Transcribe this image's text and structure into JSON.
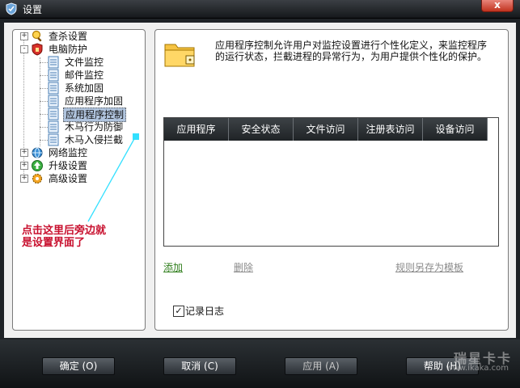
{
  "window": {
    "title": "设置",
    "close_label": "x"
  },
  "tree": {
    "items": [
      {
        "label": "查杀设置",
        "expander": "+"
      },
      {
        "label": "电脑防护",
        "expander": "-"
      },
      {
        "label": "文件监控"
      },
      {
        "label": "邮件监控"
      },
      {
        "label": "系统加固"
      },
      {
        "label": "应用程序加固"
      },
      {
        "label": "应用程序控制",
        "selected": true
      },
      {
        "label": "木马行为防御"
      },
      {
        "label": "木马入侵拦截"
      },
      {
        "label": "网络监控",
        "expander": "+"
      },
      {
        "label": "升级设置",
        "expander": "+"
      },
      {
        "label": "高级设置",
        "expander": "+"
      }
    ]
  },
  "annotation": {
    "line1": "点击这里后旁边就",
    "line2": "是设置界面了"
  },
  "panel": {
    "description": "应用程序控制允许用户对监控设置进行个性化定义，来监控程序的运行状态，拦截进程的异常行为，为用户提供个性化的保护。",
    "table_headers": [
      "应用程序",
      "安全状态",
      "文件访问",
      "注册表访问",
      "设备访问"
    ],
    "links": {
      "add": "添加",
      "delete": "删除",
      "save_template": "规则另存为模板"
    },
    "log_checkbox": {
      "label": "记录日志",
      "checked": true,
      "mark": "✓"
    }
  },
  "buttons": {
    "ok": "确定 (O)",
    "cancel": "取消 (C)",
    "apply": "应用 (A)",
    "help": "帮助 (H)"
  },
  "watermark": {
    "brand": "瑞星卡卡",
    "url": "www.ikaka.com"
  }
}
